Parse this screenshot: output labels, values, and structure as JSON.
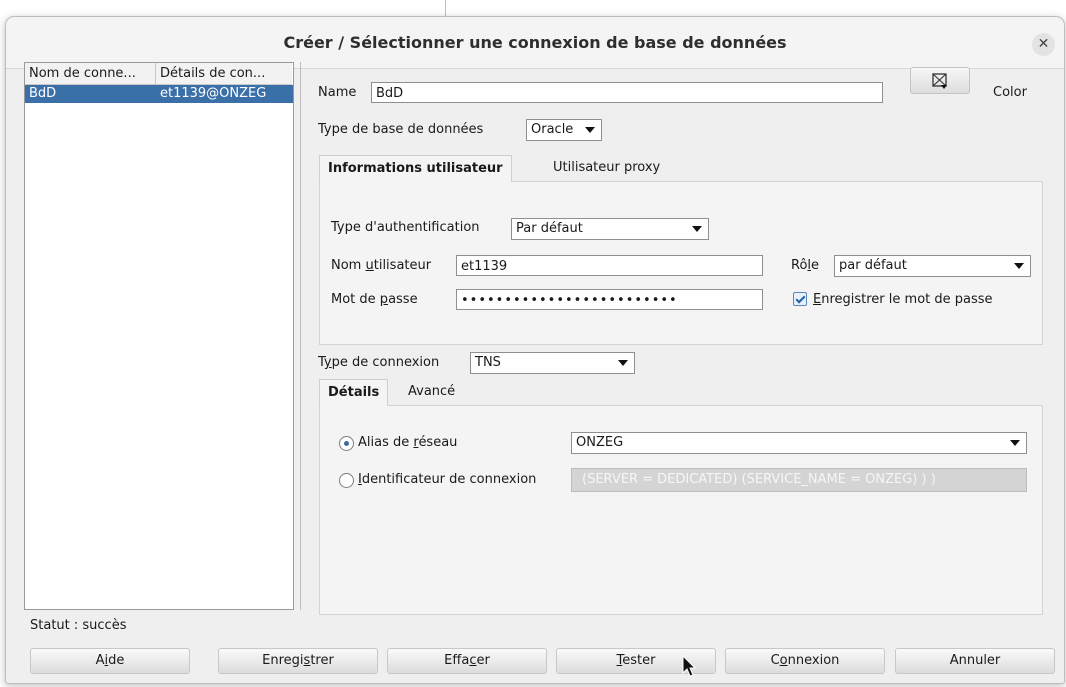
{
  "dialog": {
    "title": "Créer / Sélectionner une connexion de base de données",
    "close_icon": "close-icon"
  },
  "connections": {
    "headers": [
      "Nom de conne...",
      "Détails de con..."
    ],
    "rows": [
      {
        "name": "BdD",
        "details": "et1139@ONZEG",
        "selected": true
      }
    ]
  },
  "form": {
    "name_label": "Name",
    "name_value": "BdD",
    "color_label": "Color",
    "color_icon": "color-picker-icon",
    "db_type_label": "Type de base de données",
    "db_type_value": "Oracle",
    "user_tabs": [
      "Informations utilisateur",
      "Utilisateur proxy"
    ],
    "auth_type_label": "Type d'authentification",
    "auth_type_value": "Par défaut",
    "username_label_pre": "Nom ",
    "username_label_u": "u",
    "username_label_post": "tilisateur",
    "username_value": "et1139",
    "role_label_pre": "Rô",
    "role_label_u": "l",
    "role_label_post": "e",
    "role_value": "par défaut",
    "password_label_pre": "Mot de ",
    "password_label_u": "p",
    "password_label_post": "asse",
    "password_value": "•••••••••••••••••••••••••",
    "save_password_u": "E",
    "save_password_rest": "nregistrer le mot de passe",
    "save_password_checked": true,
    "conn_type_label_pre": "T",
    "conn_type_label_u": "y",
    "conn_type_label_post": "pe de connexion",
    "conn_type_value": "TNS",
    "detail_tabs": [
      "Détails",
      "Avancé"
    ],
    "alias_label_pre": "Alias de ",
    "alias_label_u": "r",
    "alias_label_post": "éseau",
    "alias_selected": true,
    "alias_value": "ONZEG",
    "identifier_u": "I",
    "identifier_rest": "dentificateur de connexion",
    "identifier_value": "(SERVER = DEDICATED)    (SERVICE_NAME = ONZEG)   ) )"
  },
  "status": "Statut : succès",
  "buttons": [
    {
      "pre": "A",
      "u": "i",
      "post": "de"
    },
    {
      "pre": "Enregi",
      "u": "s",
      "post": "trer"
    },
    {
      "pre": "Effa",
      "u": "c",
      "post": "er"
    },
    {
      "pre": "",
      "u": "T",
      "post": "ester"
    },
    {
      "pre": "C",
      "u": "o",
      "post": "nnexion"
    },
    {
      "pre": "Annuler",
      "u": "",
      "post": ""
    }
  ]
}
